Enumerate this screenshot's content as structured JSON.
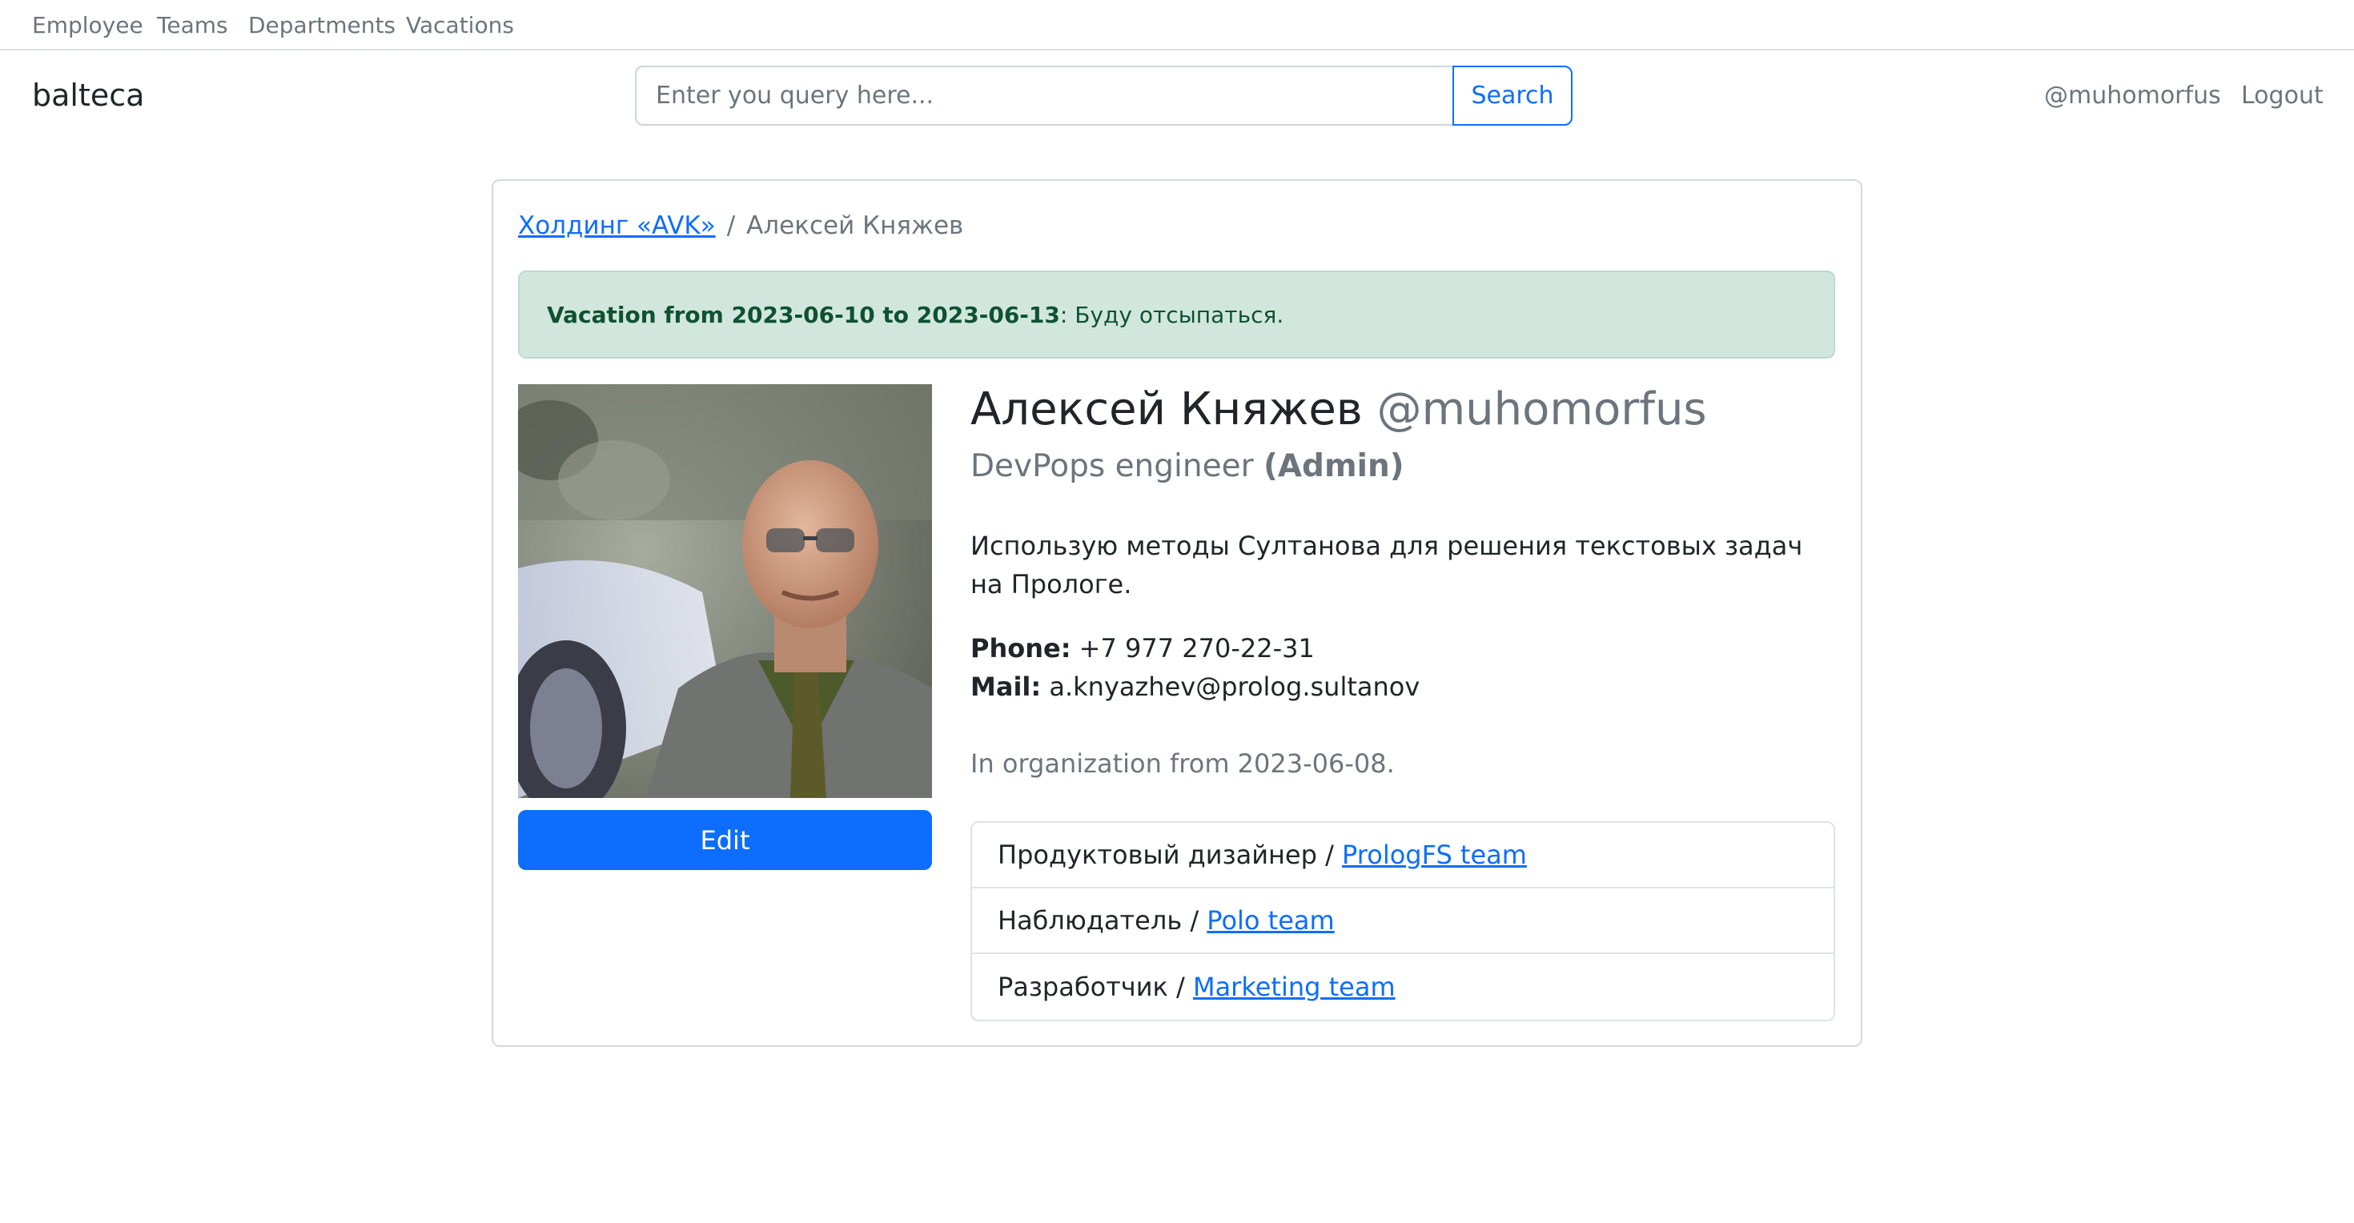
{
  "topnav": {
    "items": [
      {
        "label": "Employee"
      },
      {
        "label": "Teams"
      },
      {
        "label": "Departments"
      },
      {
        "label": "Vacations"
      }
    ]
  },
  "header": {
    "brand": "balteca",
    "search": {
      "placeholder": "Enter you query here...",
      "button_label": "Search"
    },
    "user": "@muhomorfus",
    "logout_label": "Logout"
  },
  "breadcrumb": {
    "parent": "Холдинг «AVK»",
    "separator": "/",
    "current": "Алексей Княжев"
  },
  "alert": {
    "vacation_text": "Vacation from 2023-06-10 to 2023-06-13",
    "colon": ":",
    "comment": " Буду отсыпаться."
  },
  "profile": {
    "full_name": "Алексей Княжев",
    "handle": "@muhomorfus",
    "position": "DevPops engineer",
    "role": "(Admin)",
    "bio": "Использую методы Султанова для решения текстовых задач на Прологе.",
    "phone_label": "Phone:",
    "phone": "+7 977 270-22-31",
    "mail_label": "Mail:",
    "mail": "a.knyazhev@prolog.sultanov",
    "since_text": "In organization from 2023-06-08.",
    "edit_label": "Edit"
  },
  "teams": [
    {
      "role": "Продуктовый дизайнер / ",
      "team": "PrologFS team"
    },
    {
      "role": "Наблюдатель / ",
      "team": "Polo team"
    },
    {
      "role": "Разработчик / ",
      "team": "Marketing team"
    }
  ],
  "colors": {
    "primary": "#0d6efd",
    "muted": "#6c757d",
    "alert_bg": "#d1e7dd",
    "alert_text": "#0f5132"
  }
}
